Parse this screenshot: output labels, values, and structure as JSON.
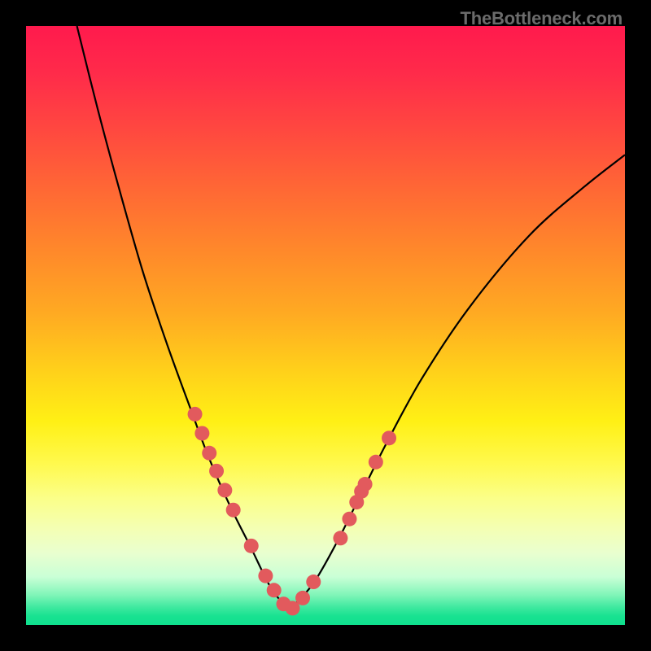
{
  "watermark": "TheBottleneck.com",
  "chart_data": {
    "type": "line",
    "title": "",
    "xlabel": "",
    "ylabel": "",
    "background": "vertical-gradient red→orange→yellow→green",
    "curve_description": "V-shaped bottleneck curve; descends from top-left, bottoms out near x≈0.42, rises toward right",
    "xlim": [
      0,
      1
    ],
    "ylim": [
      0,
      1
    ],
    "left_curve_anchor_points_xy": [
      [
        0.085,
        0.0
      ],
      [
        0.12,
        0.14
      ],
      [
        0.155,
        0.27
      ],
      [
        0.195,
        0.41
      ],
      [
        0.235,
        0.53
      ],
      [
        0.275,
        0.64
      ],
      [
        0.305,
        0.72
      ],
      [
        0.34,
        0.8
      ],
      [
        0.375,
        0.87
      ],
      [
        0.41,
        0.94
      ],
      [
        0.44,
        0.975
      ]
    ],
    "right_curve_anchor_points_xy": [
      [
        0.44,
        0.975
      ],
      [
        0.48,
        0.93
      ],
      [
        0.52,
        0.86
      ],
      [
        0.56,
        0.78
      ],
      [
        0.6,
        0.7
      ],
      [
        0.66,
        0.59
      ],
      [
        0.74,
        0.47
      ],
      [
        0.84,
        0.35
      ],
      [
        0.93,
        0.27
      ],
      [
        1.0,
        0.215
      ]
    ],
    "markers_xy": [
      [
        0.282,
        0.648
      ],
      [
        0.294,
        0.68
      ],
      [
        0.306,
        0.713
      ],
      [
        0.318,
        0.743
      ],
      [
        0.332,
        0.775
      ],
      [
        0.346,
        0.808
      ],
      [
        0.376,
        0.868
      ],
      [
        0.4,
        0.918
      ],
      [
        0.414,
        0.942
      ],
      [
        0.43,
        0.965
      ],
      [
        0.445,
        0.972
      ],
      [
        0.462,
        0.955
      ],
      [
        0.48,
        0.928
      ],
      [
        0.525,
        0.855
      ],
      [
        0.54,
        0.823
      ],
      [
        0.552,
        0.795
      ],
      [
        0.56,
        0.777
      ],
      [
        0.566,
        0.765
      ],
      [
        0.584,
        0.728
      ],
      [
        0.606,
        0.688
      ]
    ],
    "marker_radius_px": 9
  }
}
